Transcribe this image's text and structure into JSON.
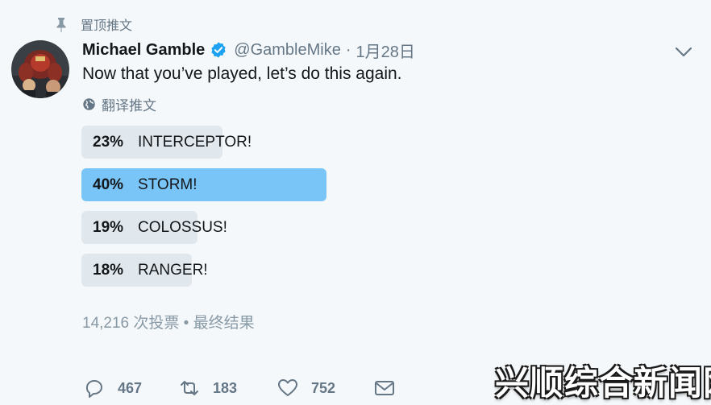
{
  "pinned_label": "置顶推文",
  "user": {
    "name": "Michael Gamble",
    "handle": "@GambleMike",
    "separator": "·",
    "date": "1月28日",
    "verified": true
  },
  "tweet_text": "Now that you’ve played, let’s do this again.",
  "translate_label": "翻译推文",
  "poll": {
    "options": [
      {
        "percent_label": "23%",
        "label": "INTERCEPTOR!",
        "percent": 23,
        "winner": false
      },
      {
        "percent_label": "40%",
        "label": "STORM!",
        "percent": 40,
        "winner": true
      },
      {
        "percent_label": "19%",
        "label": "COLOSSUS!",
        "percent": 19,
        "winner": false
      },
      {
        "percent_label": "18%",
        "label": "RANGER!",
        "percent": 18,
        "winner": false
      }
    ],
    "summary": "14,216 次投票 • 最终结果"
  },
  "actions": {
    "replies": "467",
    "retweets": "183",
    "likes": "752"
  },
  "watermark": "兴顺综合新闻网",
  "colors": {
    "background": "#f5f8fa",
    "text": "#14171a",
    "secondary": "#657786",
    "verified": "#1da1f2",
    "poll_bar": "#e1e8ed",
    "poll_winner": "#79c5f7"
  },
  "icons": [
    "pin-icon",
    "verified-badge-icon",
    "chevron-down-icon",
    "globe-icon",
    "reply-icon",
    "retweet-icon",
    "like-icon",
    "message-icon"
  ]
}
